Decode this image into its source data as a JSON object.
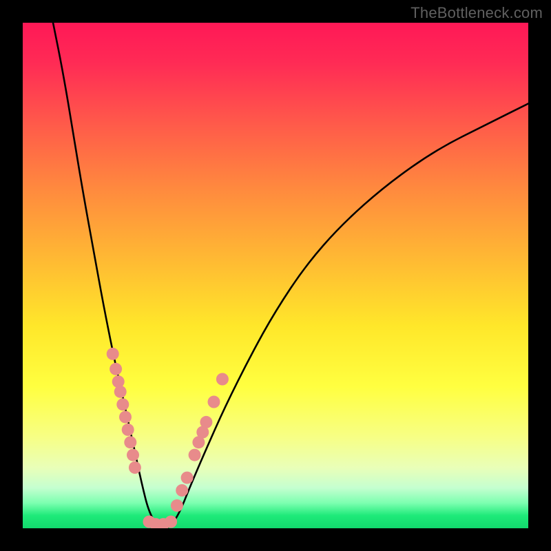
{
  "watermark": "TheBottleneck.com",
  "chart_data": {
    "type": "line",
    "title": "",
    "xlabel": "",
    "ylabel": "",
    "xlim": [
      0,
      100
    ],
    "ylim": [
      0,
      100
    ],
    "series": [
      {
        "name": "bottleneck-curve",
        "x": [
          6,
          8,
          10,
          12,
          14,
          16,
          18,
          20,
          22,
          23.5,
          25,
          27,
          29,
          31,
          33,
          36,
          40,
          45,
          50,
          56,
          63,
          72,
          82,
          92,
          100
        ],
        "y": [
          100,
          90,
          78,
          66,
          55,
          44,
          34,
          25,
          16,
          9,
          3,
          0,
          0,
          3,
          8,
          15,
          24,
          34,
          43,
          52,
          60,
          68,
          75,
          80,
          84
        ]
      }
    ],
    "markers_left": {
      "name": "dots-left-branch",
      "x": [
        17.8,
        18.4,
        18.9,
        19.3,
        19.8,
        20.3,
        20.8,
        21.3,
        21.8,
        22.2
      ],
      "y": [
        34.5,
        31.5,
        29.0,
        27.0,
        24.5,
        22.0,
        19.5,
        17.0,
        14.5,
        12.0
      ]
    },
    "markers_right": {
      "name": "dots-right-branch",
      "x": [
        30.5,
        31.5,
        32.5,
        34.0,
        34.8,
        35.6,
        36.3,
        37.8,
        39.5
      ],
      "y": [
        4.5,
        7.5,
        10.0,
        14.5,
        17.0,
        19.0,
        21.0,
        25.0,
        29.5
      ]
    },
    "markers_bottom": {
      "name": "dots-minimum",
      "x": [
        25.0,
        26.3,
        27.8,
        29.3
      ],
      "y": [
        1.3,
        0.8,
        0.8,
        1.3
      ]
    },
    "marker_color": "#e88b8b",
    "marker_radius_px": 9
  }
}
